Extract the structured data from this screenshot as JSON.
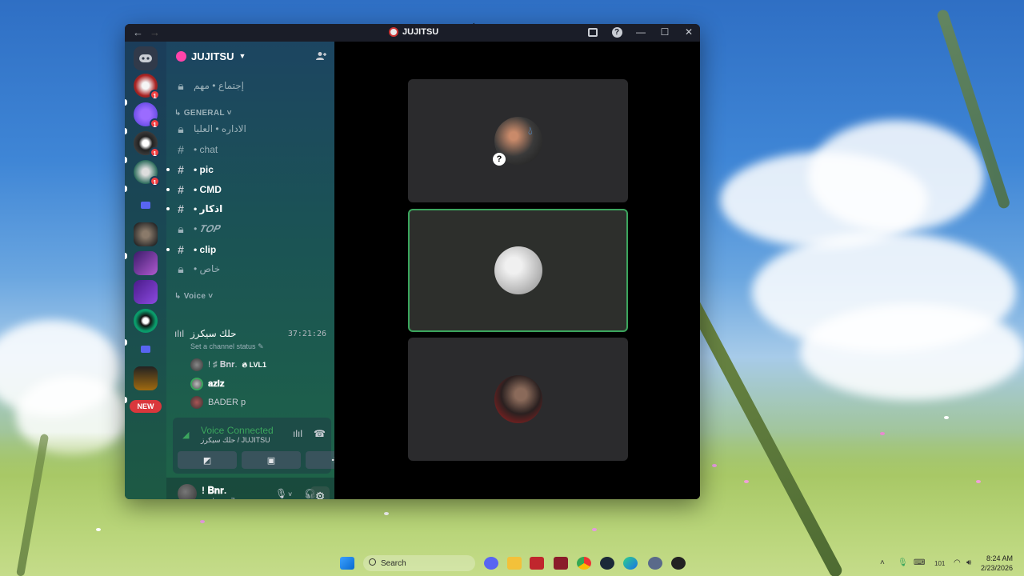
{
  "window": {
    "title": "JUJITSU",
    "nav_back": "←",
    "nav_forward": "→"
  },
  "server": {
    "name": "JUJITSU",
    "rail_badges": [
      "1",
      "1",
      "1",
      "1"
    ],
    "new_badge": "NEW"
  },
  "channels": {
    "top_locked": "إجتماع • مهم",
    "category_general": "GENERAL",
    "list": [
      {
        "label": "الاداره • العليا",
        "type": "locked",
        "unread": false
      },
      {
        "label": "• chat",
        "type": "text",
        "unread": false
      },
      {
        "label": "• pic",
        "type": "text",
        "unread": true
      },
      {
        "label": "• CMD",
        "type": "text",
        "unread": true
      },
      {
        "label": "• اذكار",
        "type": "text",
        "unread": true
      },
      {
        "label": "• 𝑻𝑶𝑷",
        "type": "locked",
        "unread": false
      },
      {
        "label": "• clip",
        "type": "text",
        "unread": true
      },
      {
        "label": "• خاص",
        "type": "locked",
        "unread": false
      }
    ],
    "category_voice": "Voice",
    "voice_channel": {
      "name": "حلك سيكرز",
      "timer": "37:21:26",
      "status_prompt": "Set a channel status",
      "users": [
        {
          "name": "! ♯ 𝐁𝐧𝐫.",
          "tag": "LVL1"
        },
        {
          "name": "𝐚𝐳𝐢𝐳",
          "tag": ""
        },
        {
          "name": "BADER p",
          "tag": ""
        }
      ]
    }
  },
  "voice_panel": {
    "title": "Voice Connected",
    "subtitle": "حلك سيكرز / JUJITSU"
  },
  "user_panel": {
    "name": "! 𝐁𝐧𝐫.",
    "tag": "bnr_g7"
  },
  "taskbar": {
    "search_placeholder": "Search",
    "time": "8:24 AM",
    "date": "2/23/2026",
    "tray_lang": "101"
  },
  "colors": {
    "speaking": "#3ba55d",
    "mention_badge": "#f23f42",
    "new_badge": "#da373c"
  }
}
